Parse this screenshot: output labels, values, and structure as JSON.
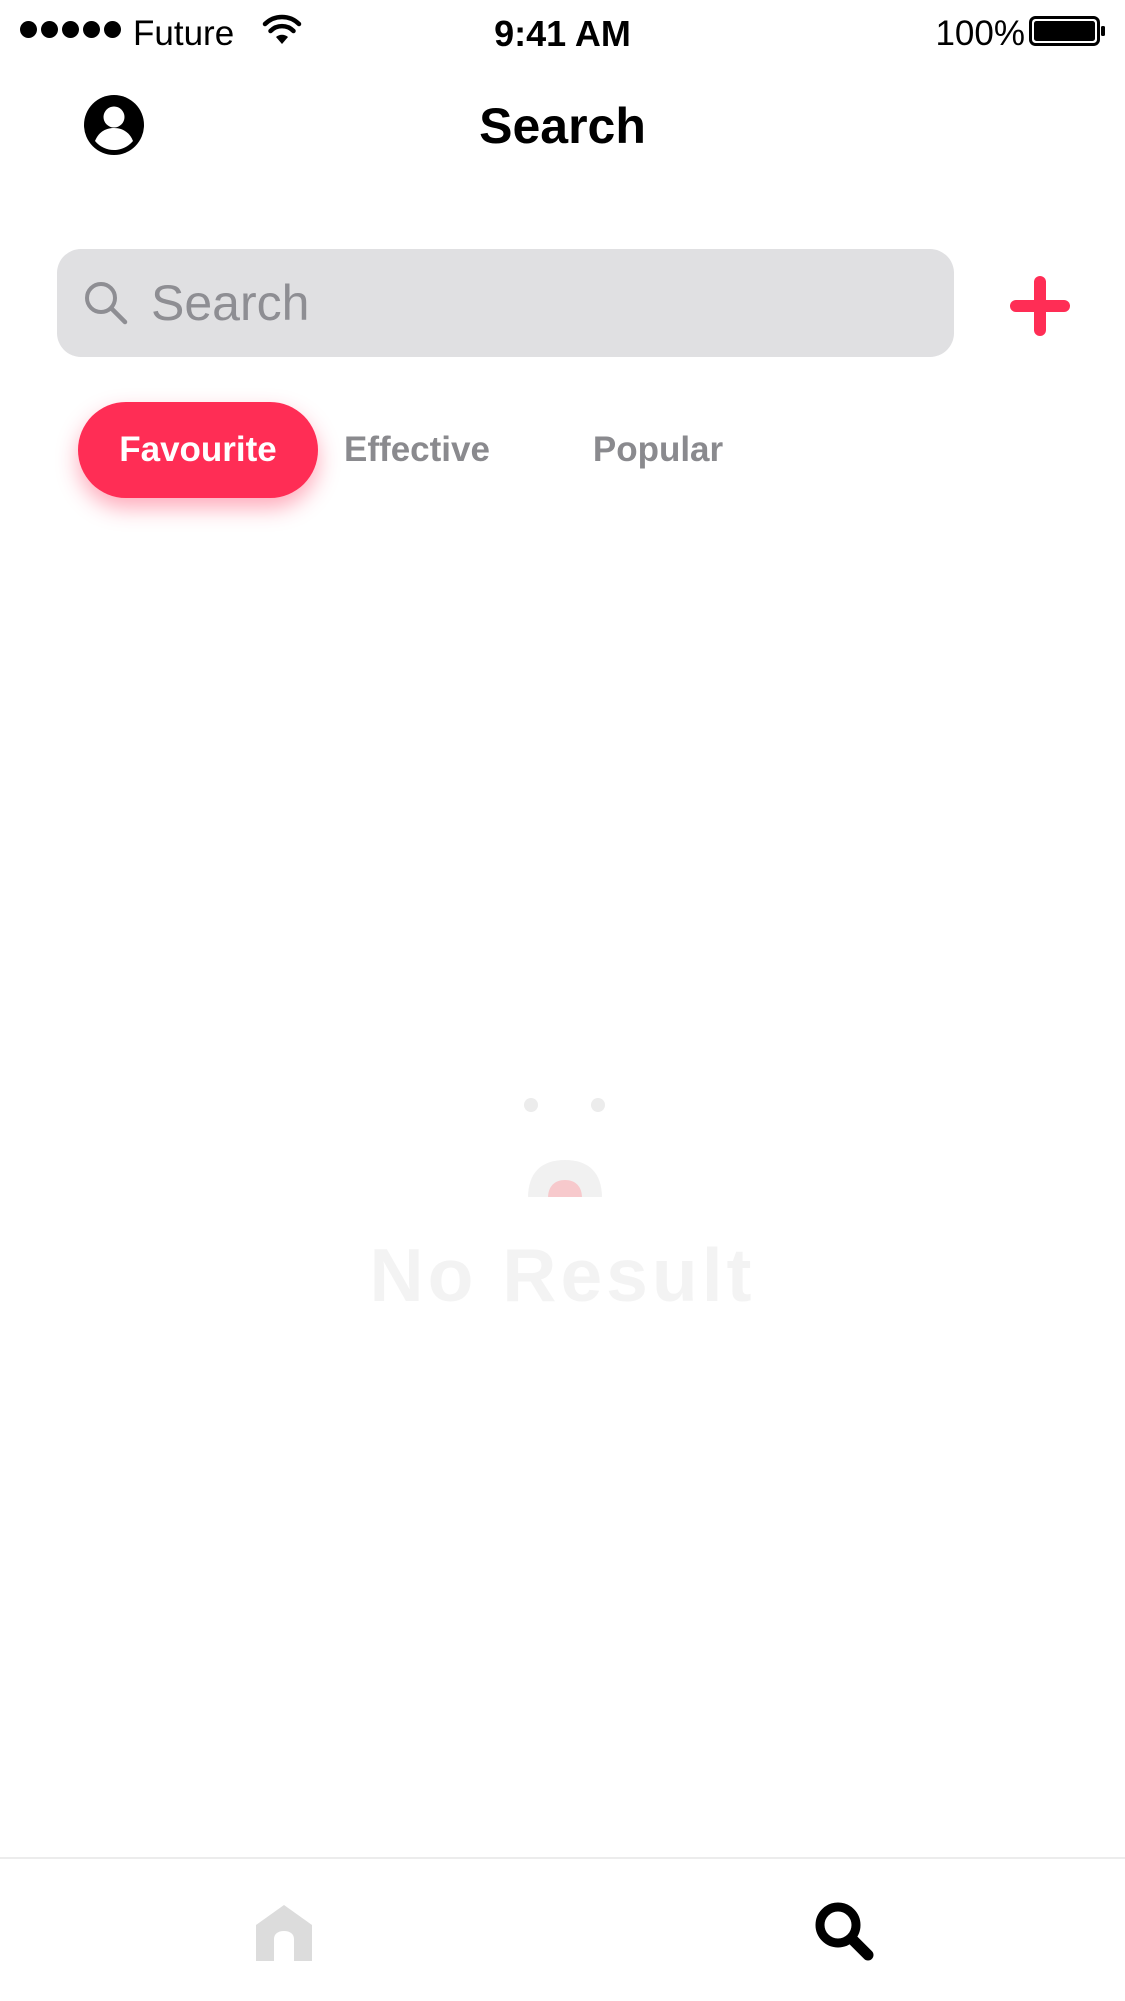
{
  "status_bar": {
    "carrier": "Future",
    "time": "9:41 AM",
    "battery": "100%",
    "icons": [
      "signal-dots-icon",
      "wifi-icon",
      "battery-icon"
    ]
  },
  "header": {
    "title": "Search",
    "left_icon": "profile-icon"
  },
  "search": {
    "placeholder": "Search",
    "value": "",
    "icon": "search-icon",
    "add_icon": "plus-icon"
  },
  "filters": {
    "tabs": [
      {
        "label": "Favourite",
        "active": true
      },
      {
        "label": "Effective",
        "active": false
      },
      {
        "label": "Popular",
        "active": false
      }
    ]
  },
  "empty_state": {
    "message": "No Result",
    "icon": "sad-face-icon"
  },
  "tab_bar": {
    "items": [
      {
        "icon": "home-icon",
        "active": false
      },
      {
        "icon": "search-icon",
        "active": true
      }
    ]
  },
  "colors": {
    "accent": "#ff2d55",
    "search_background": "#e0e0e2",
    "inactive_text": "#8a8a8e",
    "inactive_icon": "#dcdcdc",
    "empty_text": "#f3f3f3"
  }
}
